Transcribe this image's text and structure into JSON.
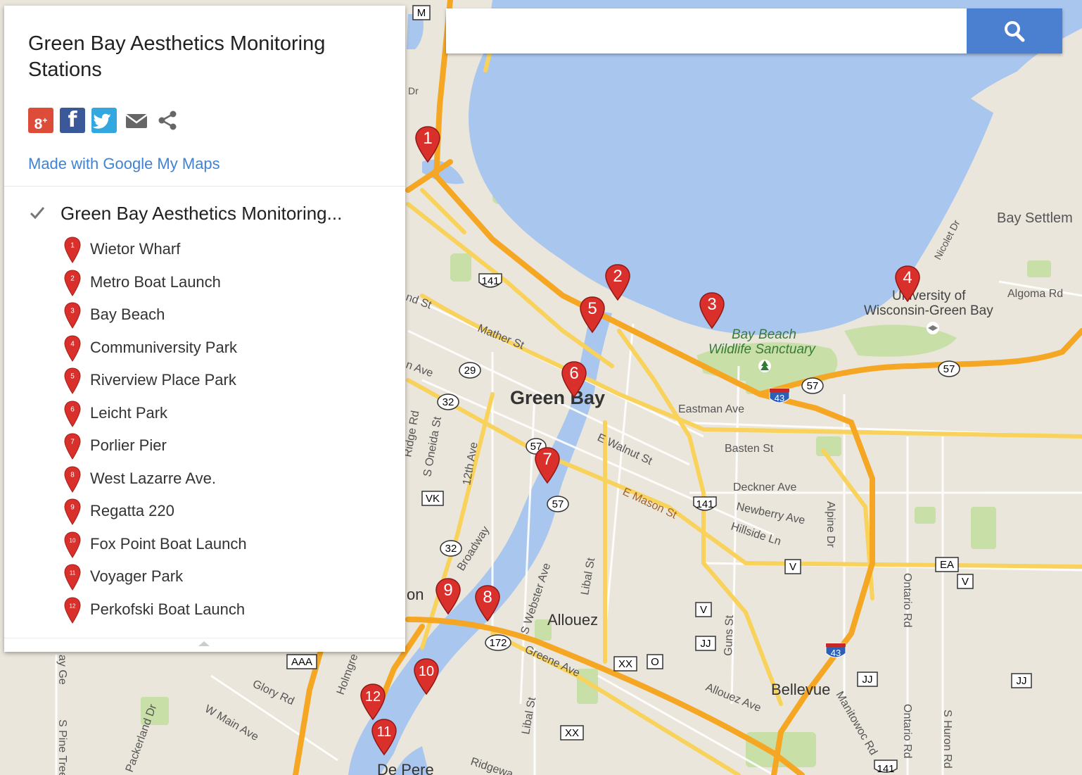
{
  "panel": {
    "title": "Green Bay Aesthetics Monitoring Stations",
    "made_with": "Made with Google My Maps",
    "layer_title": "Green Bay Aesthetics Monitoring...",
    "stations": [
      {
        "num": "1",
        "name": "Wietor Wharf"
      },
      {
        "num": "2",
        "name": "Metro Boat Launch"
      },
      {
        "num": "3",
        "name": "Bay Beach"
      },
      {
        "num": "4",
        "name": "Communiversity Park"
      },
      {
        "num": "5",
        "name": "Riverview Place Park"
      },
      {
        "num": "6",
        "name": "Leicht Park"
      },
      {
        "num": "7",
        "name": "Porlier Pier"
      },
      {
        "num": "8",
        "name": "West Lazarre Ave."
      },
      {
        "num": "9",
        "name": "Regatta 220"
      },
      {
        "num": "10",
        "name": "Fox Point Boat Launch"
      },
      {
        "num": "11",
        "name": "Voyager Park"
      },
      {
        "num": "12",
        "name": "Perkofski Boat Launch"
      }
    ]
  },
  "search": {
    "value": ""
  },
  "icons": {
    "social": [
      "google-plus-icon",
      "facebook-icon",
      "twitter-icon",
      "email-icon",
      "share-icon"
    ],
    "search": "search-icon",
    "pin": "map-pin-icon"
  },
  "colors": {
    "water": "#a9c6ee",
    "land": "#ebe6dc",
    "park": "#c9dfa8",
    "highway": "#f5a623",
    "road": "#f8d25a",
    "pin": "#d9302c",
    "link": "#4083d4",
    "search_button": "#4b7fd0"
  },
  "map": {
    "labels": {
      "green_bay": "Green Bay",
      "allouez": "Allouez",
      "bellevue": "Bellevue",
      "de_pere": "De Pere",
      "bay_settlement": "Bay Settlem",
      "uwgb_1": "University of",
      "uwgb_2": "Wisconsin-Green Bay",
      "sanctuary_1": "Bay Beach",
      "sanctuary_2": "Wildlife Sanctuary",
      "on": "on",
      "mather": "Mather St",
      "eastman": "Eastman Ave",
      "basten": "Basten St",
      "walnut": "E Walnut St",
      "mason": "E Mason St",
      "deckner": "Deckner Ave",
      "newberry": "Newberry Ave",
      "hillside": "Hillside Ln",
      "alpine": "Alpine Dr",
      "ontario_1": "Ontario Rd",
      "ontario_2": "Ontario Rd",
      "huron": "S Huron Rd",
      "algoma": "Algoma Rd",
      "nicolet": "Nicolet Dr",
      "oneida": "S Oneida St",
      "twelfth": "12th Ave",
      "ridge": "Ridge Rd",
      "broadway": "Broadway",
      "webster": "S Webster Ave",
      "libal_1": "Libal St",
      "libal_2": "Libal St",
      "greene": "Greene Ave",
      "allouez_ave": "Allouez Ave",
      "manitowoc": "Manitowoc Rd",
      "guns": "Guns St",
      "glory": "Glory Rd",
      "wmain": "W Main Ave",
      "holmgren": "Holmgre",
      "packerland": "Packerland Dr",
      "spine": "S Pine Tree",
      "ridgeway": "Ridgewa",
      "ndst": "nd St",
      "nave": "n Ave",
      "dr": "Dr",
      "ge": "ay Ge"
    },
    "shields": {
      "us141_a": "141",
      "us141_b": "141",
      "us141_c": "141",
      "wi29": "29",
      "wi32_a": "32",
      "wi32_b": "32",
      "wi57_a": "57",
      "wi57_b": "57",
      "wi57_c": "57",
      "wi57_d": "57",
      "wi172": "172",
      "i43_a": "43",
      "i43_b": "43",
      "vk": "VK",
      "v_a": "V",
      "v_b": "V",
      "v_c": "V",
      "jj_a": "JJ",
      "jj_b": "JJ",
      "jj_c": "JJ",
      "xx_a": "XX",
      "xx_b": "XX",
      "o": "O",
      "aaa": "AAA",
      "ea": "EA",
      "m": "M"
    },
    "markers": [
      {
        "num": "1"
      },
      {
        "num": "2"
      },
      {
        "num": "3"
      },
      {
        "num": "4"
      },
      {
        "num": "5"
      },
      {
        "num": "6"
      },
      {
        "num": "7"
      },
      {
        "num": "8"
      },
      {
        "num": "9"
      },
      {
        "num": "10"
      },
      {
        "num": "11"
      },
      {
        "num": "12"
      }
    ]
  }
}
